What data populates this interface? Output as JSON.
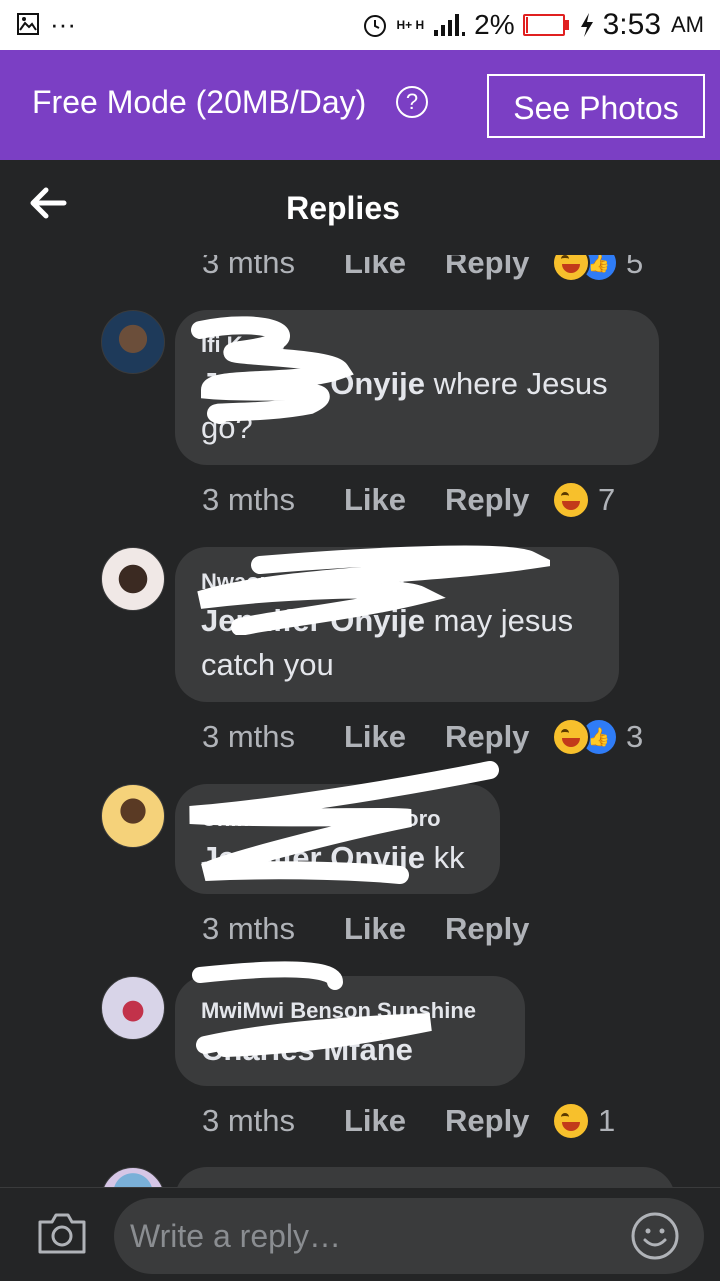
{
  "status_bar": {
    "net_label": "H+ H",
    "battery_percent": "2%",
    "battery_level": 0.02,
    "time": "3:53",
    "ampm": "AM"
  },
  "banner": {
    "text": "Free Mode (20MB/Day)",
    "help_icon": "?",
    "button_label": "See Photos",
    "color": "#7b3fc4"
  },
  "header": {
    "title": "Replies",
    "back_icon": "back-arrow-icon"
  },
  "top_meta": {
    "time": "3 mths",
    "like": "Like",
    "reply": "Reply",
    "reactions": [
      "haha",
      "like"
    ],
    "count": "5"
  },
  "comments": [
    {
      "author": "Ifi Kesty",
      "mention": "Jennifer Onyije",
      "text": " where Jesus go?",
      "meta": {
        "time": "3 mths",
        "like": "Like",
        "reply": "Reply",
        "reactions": [
          "haha"
        ],
        "count": "7"
      }
    },
    {
      "author": "Nwaonuma Michael",
      "mention": "Jennifer Onyije",
      "text": " may jesus catch you",
      "meta": {
        "time": "3 mths",
        "like": "Like",
        "reply": "Reply",
        "reactions": [
          "haha",
          "like"
        ],
        "count": "3"
      }
    },
    {
      "author": "Chimmachukwu Okoro",
      "mention": "Jennifer Onyije",
      "text": " kk",
      "meta": {
        "time": "3 mths",
        "like": "Like",
        "reply": "Reply",
        "reactions": [],
        "count": ""
      }
    },
    {
      "author": "MwiMwi Benson Sunshine",
      "mention": "Charles Mfane",
      "text": "",
      "meta": {
        "time": "3 mths",
        "like": "Like",
        "reply": "Reply",
        "reactions": [
          "haha"
        ],
        "count": "1"
      }
    }
  ],
  "composer": {
    "placeholder": "Write a reply…",
    "camera_icon": "camera-icon",
    "emoji_icon": "smiley-icon"
  },
  "colors": {
    "background": "#242526",
    "bubble": "#3a3b3c",
    "text": "#e4e6eb",
    "meta": "#b0b3b8"
  }
}
